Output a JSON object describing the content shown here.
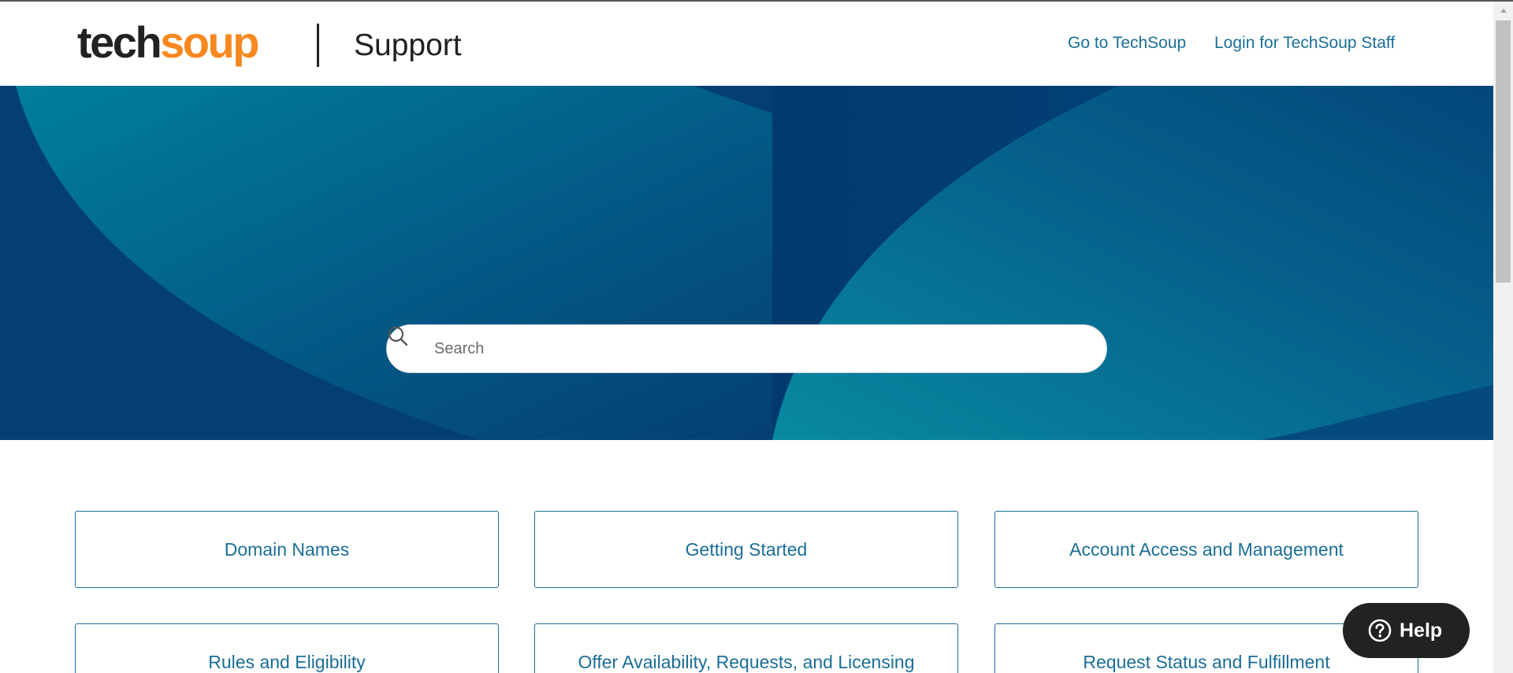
{
  "header": {
    "logo": {
      "part1": "tech",
      "part2": "soup"
    },
    "site_title": "Support",
    "nav": [
      {
        "label": "Go to TechSoup"
      },
      {
        "label": "Login for TechSoup Staff"
      }
    ]
  },
  "search": {
    "placeholder": "Search",
    "value": ""
  },
  "categories": [
    {
      "label": "Domain Names"
    },
    {
      "label": "Getting Started"
    },
    {
      "label": "Account Access and Management"
    },
    {
      "label": "Rules and Eligibility"
    },
    {
      "label": "Offer Availability, Requests, and Licensing"
    },
    {
      "label": "Request Status and Fulfillment"
    }
  ],
  "help_button": {
    "label": "Help"
  },
  "colors": {
    "brand_orange": "#f7891f",
    "link_blue": "#1b6e96",
    "hero_dark": "#043f73",
    "hero_teal": "#087a94",
    "help_bg": "#222222"
  },
  "icons": {
    "search": "search-icon",
    "help": "question-circle-icon",
    "scroll_up": "chevron-up-icon"
  }
}
